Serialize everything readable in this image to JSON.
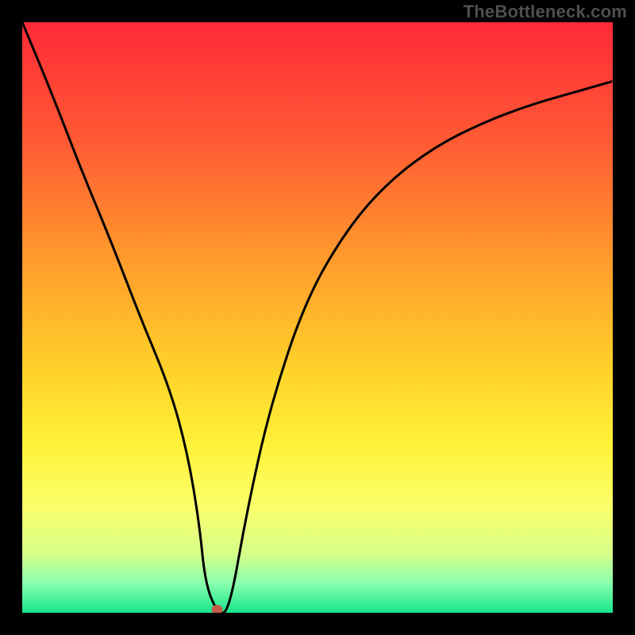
{
  "watermark": "TheBottleneck.com",
  "chart_data": {
    "type": "line",
    "title": "",
    "xlabel": "",
    "ylabel": "",
    "xlim": [
      0,
      100
    ],
    "ylim": [
      0,
      100
    ],
    "series": [
      {
        "name": "curve",
        "x": [
          0,
          5,
          10,
          15,
          20,
          25,
          28,
          30,
          31,
          33,
          35,
          38,
          42,
          48,
          55,
          62,
          70,
          78,
          86,
          93,
          100
        ],
        "y": [
          100,
          88,
          75,
          63,
          50,
          38,
          27,
          15,
          5,
          0,
          0,
          17,
          35,
          53,
          65,
          73,
          79,
          83,
          86,
          88,
          90
        ]
      }
    ],
    "marker": {
      "x": 33,
      "y": 0
    },
    "gradient_stops": [
      {
        "offset": 0.0,
        "color": "#ff2a38"
      },
      {
        "offset": 0.2,
        "color": "#ff5a34"
      },
      {
        "offset": 0.4,
        "color": "#ff9a2c"
      },
      {
        "offset": 0.6,
        "color": "#ffd52a"
      },
      {
        "offset": 0.72,
        "color": "#fff23a"
      },
      {
        "offset": 0.82,
        "color": "#fbff6a"
      },
      {
        "offset": 0.9,
        "color": "#d6ff8a"
      },
      {
        "offset": 0.95,
        "color": "#8affad"
      },
      {
        "offset": 1.0,
        "color": "#15e58c"
      }
    ]
  }
}
